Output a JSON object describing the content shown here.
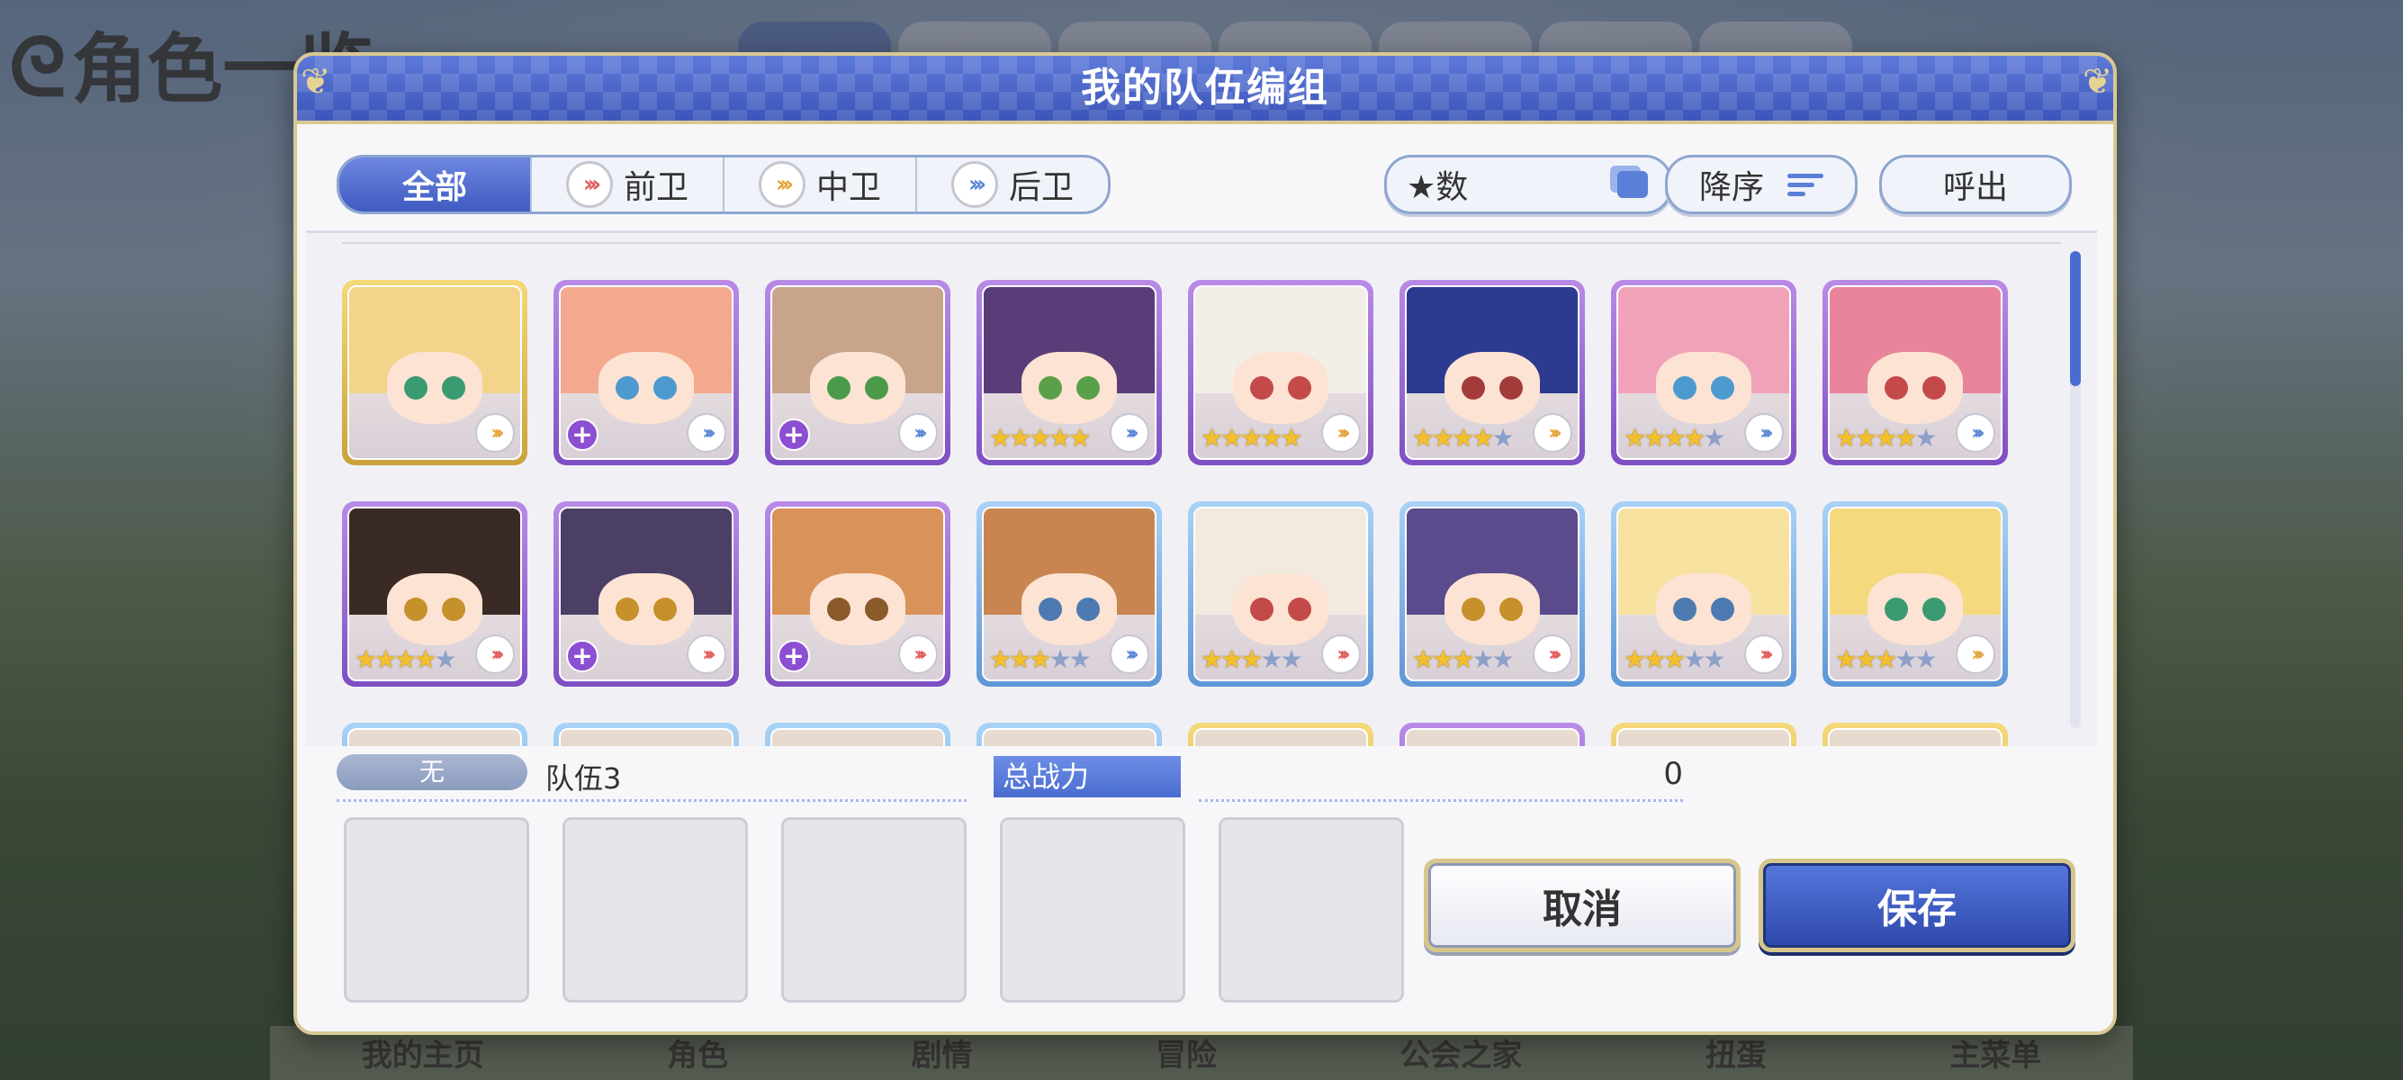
{
  "background": {
    "title": "角色一览",
    "bottom_nav": [
      "我的主页",
      "角色",
      "剧情",
      "冒险",
      "公会之家",
      "扭蛋",
      "主菜单"
    ]
  },
  "modal": {
    "title": "我的队伍编组",
    "filter_tabs": [
      {
        "label": "全部",
        "icon": null,
        "active": true
      },
      {
        "label": "前卫",
        "icon": "front-position-icon",
        "active": false
      },
      {
        "label": "中卫",
        "icon": "mid-position-icon",
        "active": false
      },
      {
        "label": "后卫",
        "icon": "back-position-icon",
        "active": false
      }
    ],
    "sort_stars_label": "★数",
    "sort_order_label": "降序",
    "call_label": "呼出",
    "characters": [
      {
        "frame": "gold",
        "stars": 0,
        "max_stars": 0,
        "plus": false,
        "position": "mid"
      },
      {
        "frame": "purple",
        "stars": 0,
        "max_stars": 0,
        "plus": true,
        "position": "back"
      },
      {
        "frame": "purple",
        "stars": 0,
        "max_stars": 0,
        "plus": true,
        "position": "back"
      },
      {
        "frame": "purple",
        "stars": 5,
        "max_stars": 5,
        "plus": false,
        "position": "back"
      },
      {
        "frame": "purple",
        "stars": 5,
        "max_stars": 5,
        "plus": false,
        "position": "mid"
      },
      {
        "frame": "purple",
        "stars": 4,
        "max_stars": 5,
        "plus": false,
        "position": "mid"
      },
      {
        "frame": "purple",
        "stars": 4,
        "max_stars": 5,
        "plus": false,
        "position": "back"
      },
      {
        "frame": "purple",
        "stars": 4,
        "max_stars": 5,
        "plus": false,
        "position": "back"
      },
      {
        "frame": "purple",
        "stars": 4,
        "max_stars": 5,
        "plus": false,
        "position": "front"
      },
      {
        "frame": "purple",
        "stars": 0,
        "max_stars": 0,
        "plus": true,
        "position": "front"
      },
      {
        "frame": "purple",
        "stars": 0,
        "max_stars": 0,
        "plus": true,
        "position": "front"
      },
      {
        "frame": "blue",
        "stars": 3,
        "max_stars": 5,
        "plus": false,
        "position": "back"
      },
      {
        "frame": "blue",
        "stars": 3,
        "max_stars": 5,
        "plus": false,
        "position": "front"
      },
      {
        "frame": "blue",
        "stars": 3,
        "max_stars": 5,
        "plus": false,
        "position": "front"
      },
      {
        "frame": "blue",
        "stars": 3,
        "max_stars": 5,
        "plus": false,
        "position": "front"
      },
      {
        "frame": "blue",
        "stars": 3,
        "max_stars": 5,
        "plus": false,
        "position": "mid"
      }
    ],
    "partial_row_frames": [
      "blue",
      "blue",
      "blue",
      "blue",
      "gold",
      "purple",
      "gold",
      "gold"
    ],
    "team": {
      "tag": "无",
      "name": "队伍3",
      "power_label": "总战力",
      "power_value": "0",
      "slots": 5
    },
    "cancel_label": "取消",
    "save_label": "保存"
  }
}
